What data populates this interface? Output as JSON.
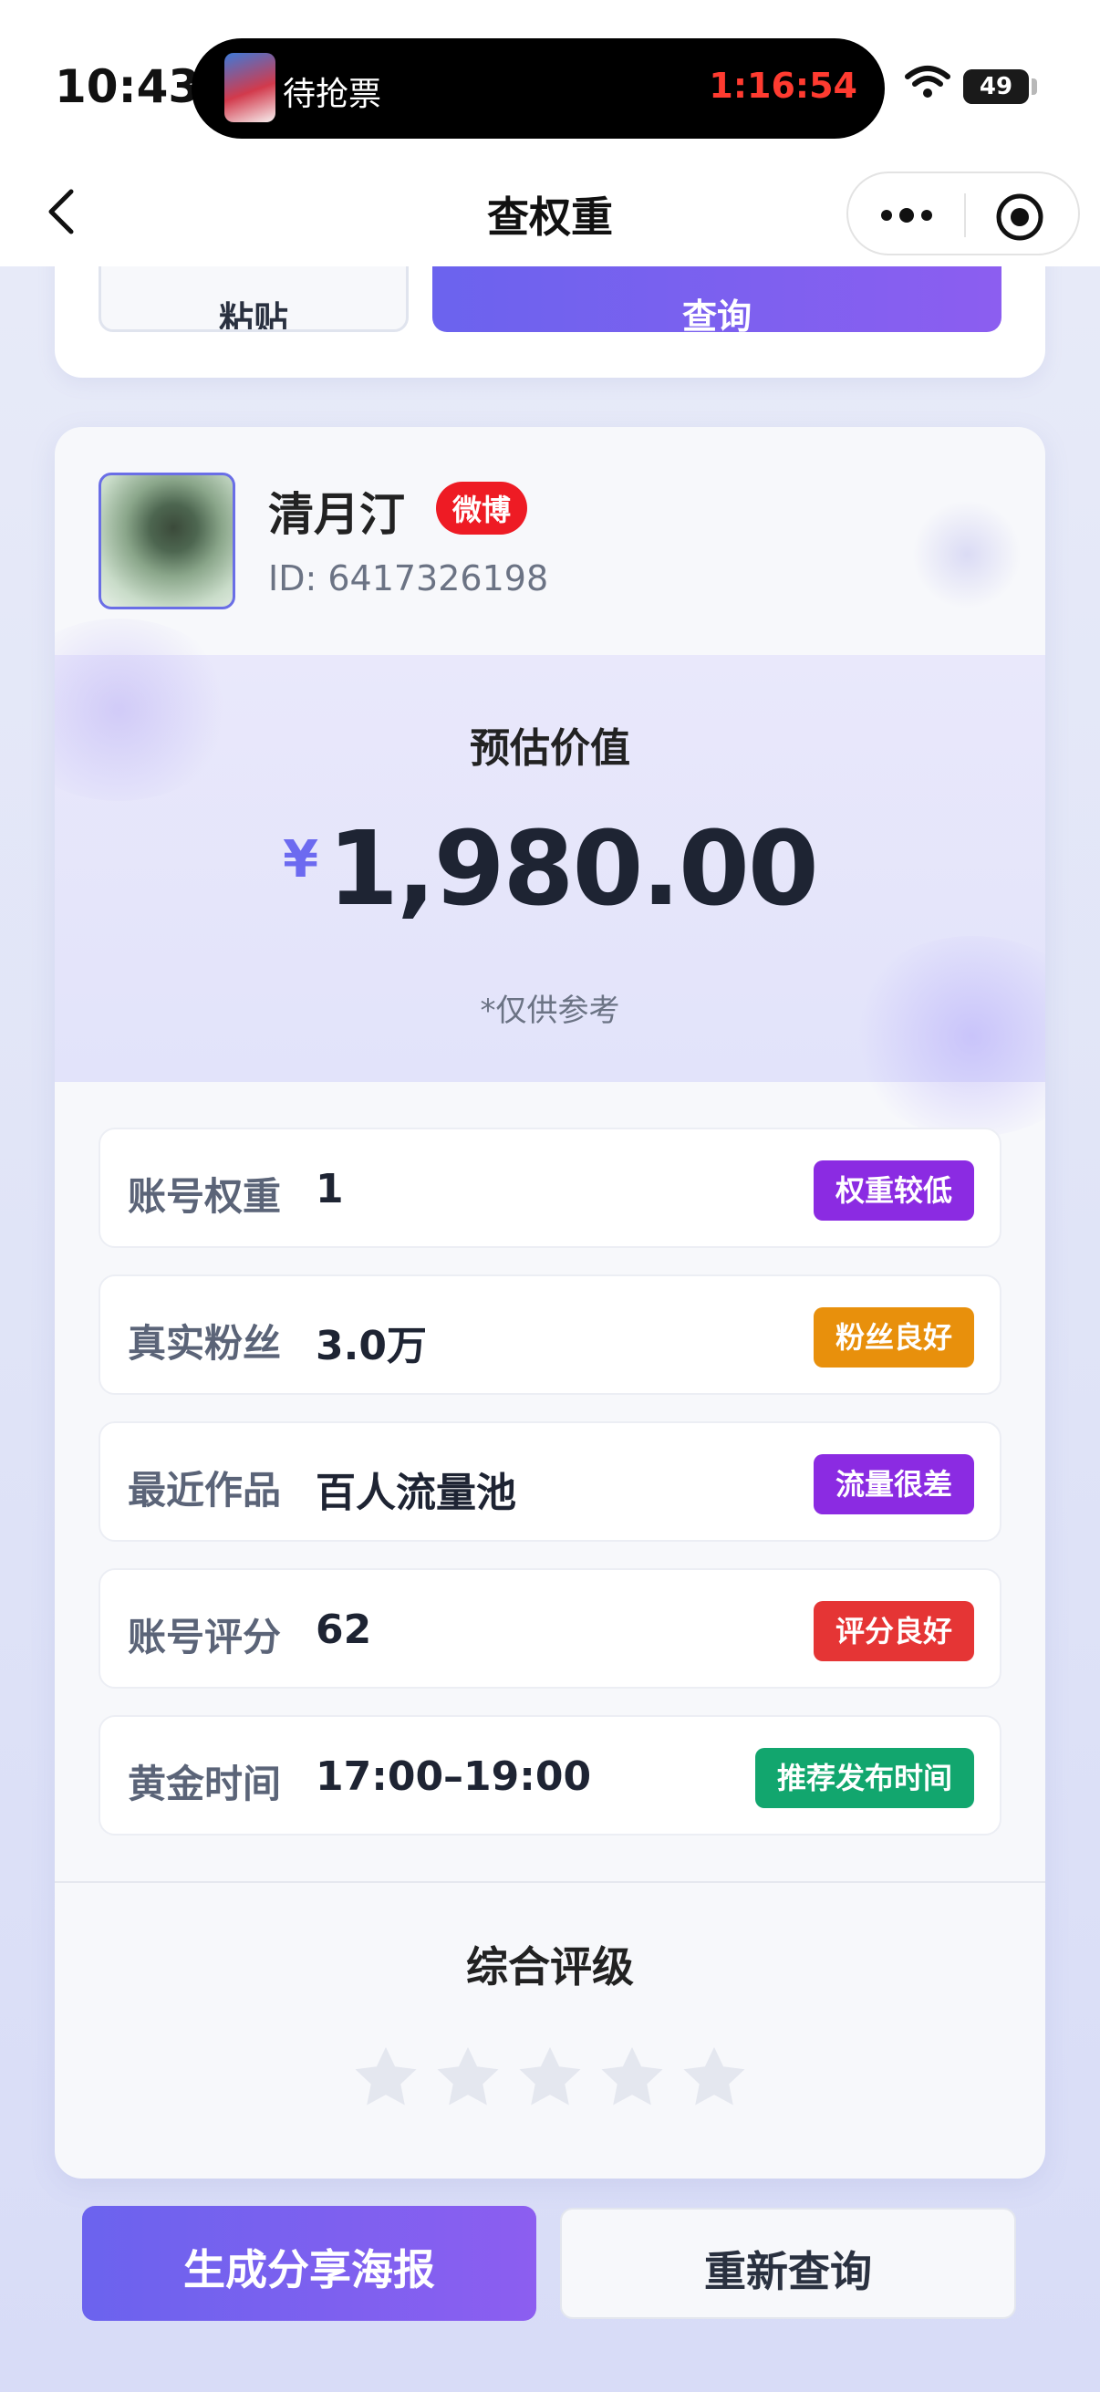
{
  "status_bar": {
    "time": "10:43",
    "activity_label": "待抢票",
    "activity_timer": "1:16:54",
    "battery": "49",
    "battery_level": 0.49,
    "icons": [
      "wifi-icon",
      "battery-icon"
    ]
  },
  "nav": {
    "title": "查权重",
    "icons": [
      "back-chevron-icon",
      "more-dots-icon",
      "target-icon"
    ]
  },
  "top_card": {
    "paste_label": "粘贴",
    "query_label": "查询"
  },
  "profile": {
    "name": "清月汀",
    "platform_badge": "微博",
    "id_text": "ID: 6417326198"
  },
  "valuation": {
    "title": "预估价值",
    "currency": "¥",
    "amount": "1,980.00",
    "note": "*仅供参考"
  },
  "metrics": [
    {
      "label": "账号权重",
      "value": "1",
      "tag": "权重较低",
      "tag_color": "#8b2be2"
    },
    {
      "label": "真实粉丝",
      "value": "3.0万",
      "tag": "粉丝良好",
      "tag_color": "#e8900c"
    },
    {
      "label": "最近作品",
      "value": "百人流量池",
      "tag": "流量很差",
      "tag_color": "#8b2be2"
    },
    {
      "label": "账号评分",
      "value": "62",
      "tag": "评分良好",
      "tag_color": "#e53535"
    },
    {
      "label": "黄金时间",
      "value": "17:00–19:00",
      "tag": "推荐发布时间",
      "tag_color": "#12a66e"
    }
  ],
  "rating": {
    "title": "综合评级",
    "stars_filled": 0,
    "stars_total": 5,
    "star_empty_color": "#e4e7ef"
  },
  "actions": {
    "share_label": "生成分享海报",
    "requery_label": "重新查询"
  },
  "colors": {
    "accent_start": "#6b63ee",
    "accent_end": "#8c5ef0",
    "badge_red": "#ee1b24",
    "timer_red": "#ff3b30"
  }
}
